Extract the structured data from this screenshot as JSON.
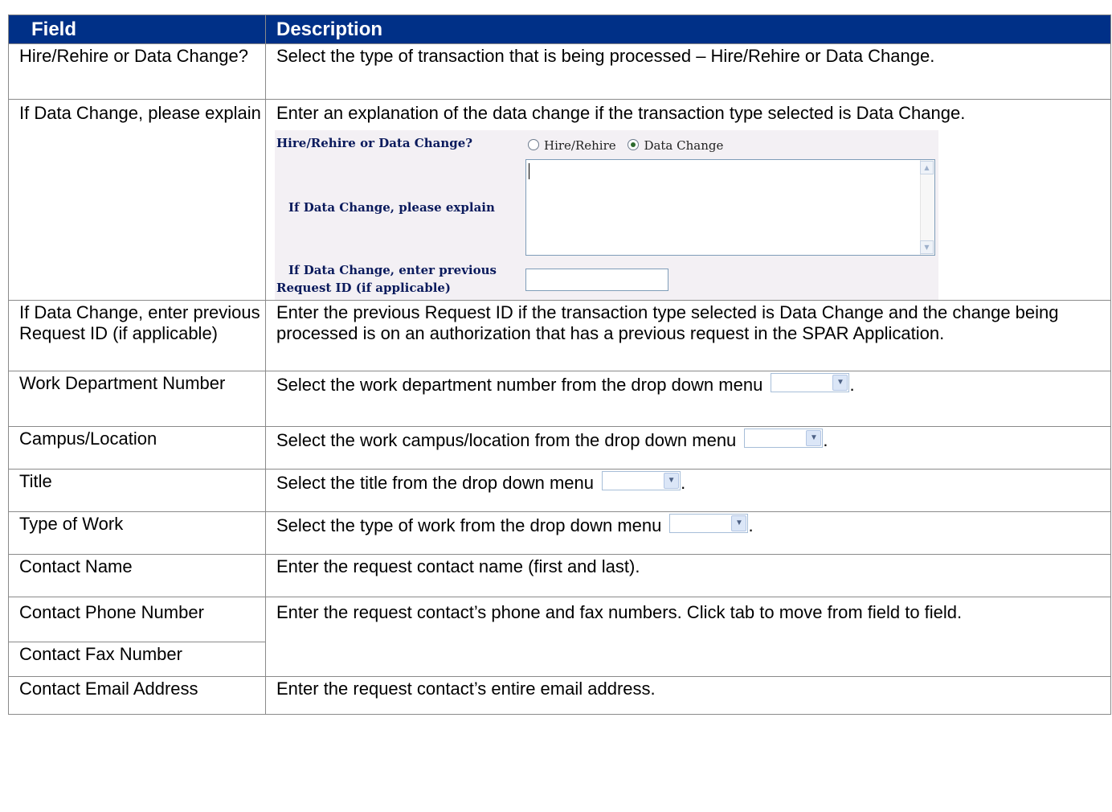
{
  "header": {
    "field": "Field",
    "description": "Description"
  },
  "rows": [
    {
      "field": "Hire/Rehire or Data Change?",
      "description": "Select the type of transaction that is being processed – Hire/Rehire or Data Change."
    },
    {
      "field": "If Data Change, please explain",
      "description": "Enter an explanation of the data change if the transaction type selected is Data Change."
    },
    {
      "field": "If Data Change, enter previous Request ID (if applicable)",
      "description": "Enter the previous Request ID if the transaction type selected is Data Change and the change being processed is on an authorization that has a previous request in the SPAR Application."
    },
    {
      "field": "Work Department Number",
      "description": "Select the work department number from the drop down menu"
    },
    {
      "field": "Campus/Location",
      "description": "Select the work campus/location from the drop down menu"
    },
    {
      "field": "Title",
      "description": "Select the title from the drop down menu"
    },
    {
      "field": "Type of Work",
      "description": "Select the type of work from the drop down menu"
    },
    {
      "field": "Contact Name",
      "description": "Enter the request contact name (first and last)."
    },
    {
      "field": "Contact Phone Number",
      "description": "Enter the request contact’s phone and fax numbers. Click tab to move from field to field."
    },
    {
      "field": "Contact Fax Number"
    },
    {
      "field": "Contact Email Address",
      "description": "Enter the request contact’s entire email address."
    }
  ],
  "form_example": {
    "q1_label": "Hire/Rehire or Data Change?",
    "option_hire": "Hire/Rehire",
    "option_data": "Data Change",
    "selected": "Data Change",
    "q2_label": "If Data Change, please explain",
    "q3_label_line1": "If Data Change, enter previous",
    "q3_label_line2": "Request ID (if applicable)"
  },
  "trailing_period": "."
}
